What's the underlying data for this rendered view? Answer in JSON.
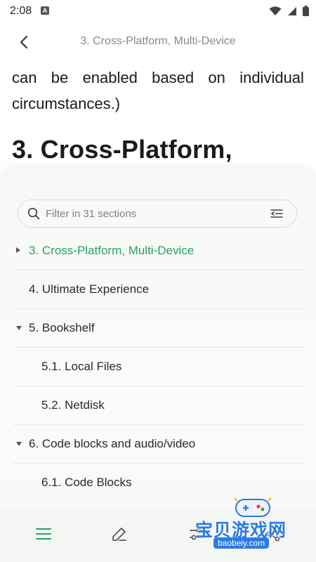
{
  "status": {
    "time": "2:08",
    "badge": "A"
  },
  "header": {
    "title": "3. Cross-Platform, Multi-Device"
  },
  "content": {
    "para_line1_words": [
      "can",
      "be",
      "enabled",
      "based",
      "on",
      "individual"
    ],
    "para_line2": "circumstances.)",
    "heading": "3. Cross-Platform,"
  },
  "toc": {
    "filter_placeholder": "Filter in 31 sections",
    "items": [
      {
        "label": "3. Cross-Platform, Multi-Device",
        "active": true,
        "arrow": "right"
      },
      {
        "label": "4. Ultimate Experience"
      },
      {
        "label": "5. Bookshelf",
        "arrow": "down"
      },
      {
        "label": "5.1. Local Files"
      },
      {
        "label": "5.2. Netdisk"
      },
      {
        "label": "6. Code blocks and audio/video",
        "arrow": "down"
      },
      {
        "label": "6.1. Code Blocks"
      }
    ]
  },
  "bottom_bar": {
    "icons": [
      "toc-icon",
      "pen-icon",
      "settings-sliders-icon",
      "share-icon"
    ]
  },
  "colors": {
    "accent": "#27a060",
    "watermark": "#2c7be5"
  },
  "watermark": {
    "text": "宝贝游戏网",
    "url": "baobeiy.com"
  }
}
